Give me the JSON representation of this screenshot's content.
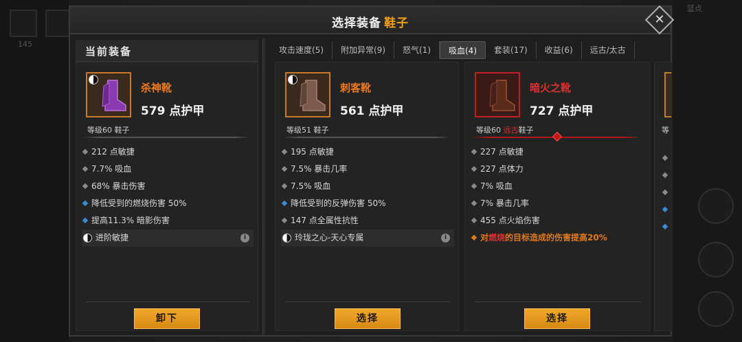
{
  "background": {
    "top_right_text": "篮点",
    "left_counter": "145",
    "left_counter2": "1"
  },
  "modal": {
    "title_prefix": "选择装备",
    "title_slot": "鞋子",
    "close_glyph": "✕"
  },
  "current": {
    "header": "当前装备"
  },
  "tabs": [
    {
      "label": "攻击速度(5)",
      "active": false
    },
    {
      "label": "附加异常(9)",
      "active": false
    },
    {
      "label": "怒气(1)",
      "active": false
    },
    {
      "label": "吸血(4)",
      "active": true
    },
    {
      "label": "套装(17)",
      "active": false
    },
    {
      "label": "收益(6)",
      "active": false
    },
    {
      "label": "远古/太古",
      "active": false
    }
  ],
  "cards": [
    {
      "name": "杀神靴",
      "armor": "579 点护甲",
      "level": "等级60 鞋子",
      "boot_color": "#8a3ab0",
      "attrs": [
        {
          "text": "212 点敏捷",
          "bullet": "gray"
        },
        {
          "text": "7.7% 吸血",
          "bullet": "gray"
        },
        {
          "text": "68% 暴击伤害",
          "bullet": "gray"
        },
        {
          "text": "降低受到的燃烧伤害 50%",
          "bullet": "blue"
        },
        {
          "text": "提高11.3% 暗影伤害",
          "bullet": "blue"
        },
        {
          "text": "进阶敏捷",
          "bullet": "yin"
        }
      ],
      "button": "卸下"
    },
    {
      "name": "刺客靴",
      "armor": "561 点护甲",
      "level": "等级51 鞋子",
      "boot_color": "#7a5a4a",
      "attrs": [
        {
          "text": "195 点敏捷",
          "bullet": "gray"
        },
        {
          "text": "7.5% 暴击几率",
          "bullet": "gray"
        },
        {
          "text": "7.5% 吸血",
          "bullet": "gray"
        },
        {
          "text": "降低受到的反弹伤害 50%",
          "bullet": "blue"
        },
        {
          "text": "147 点全属性抗性",
          "bullet": "gray"
        },
        {
          "text": "玲珑之心-天心专属",
          "bullet": "yin"
        }
      ],
      "button": "选择"
    },
    {
      "name": "暗火之靴",
      "armor": "727 点护甲",
      "level_prefix": "等级60 ",
      "level_tag": "远古",
      "level_suffix": "鞋子",
      "boot_color": "#5a2a1a",
      "attrs": [
        {
          "text": "227 点敏捷",
          "bullet": "gray"
        },
        {
          "text": "227 点体力",
          "bullet": "gray"
        },
        {
          "text": "7% 吸血",
          "bullet": "gray"
        },
        {
          "text": "7% 暴击几率",
          "bullet": "gray"
        },
        {
          "text": "455 点火焰伤害",
          "bullet": "gray"
        }
      ],
      "special": {
        "prefix": "对",
        "keyword": "燃烧",
        "suffix": "的目标造成的伤害提高20%"
      },
      "button": "选择"
    }
  ],
  "peek_card": {
    "level": "等"
  },
  "info_glyph": "i"
}
